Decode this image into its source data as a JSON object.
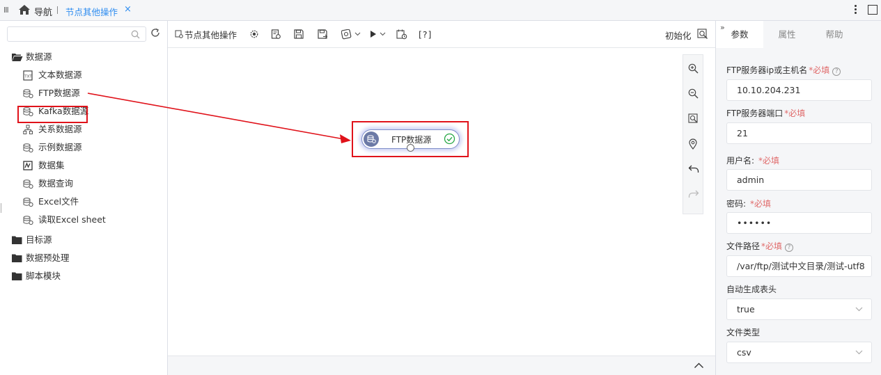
{
  "topbar": {
    "nav_label": "导航",
    "active_tab": "节点其他操作",
    "close_glyph": "×"
  },
  "tree": {
    "search_placeholder": "",
    "groups": [
      {
        "label": "数据源",
        "expanded": true,
        "items": [
          {
            "label": "文本数据源",
            "icon": "text-source-icon"
          },
          {
            "label": "FTP数据源",
            "icon": "database-source-icon",
            "highlighted": true
          },
          {
            "label": "Kafka数据源",
            "icon": "database-source-icon"
          },
          {
            "label": "关系数据源",
            "icon": "relation-source-icon"
          },
          {
            "label": "示例数据源",
            "icon": "database-source-icon"
          },
          {
            "label": "数据集",
            "icon": "dataset-icon"
          },
          {
            "label": "数据查询",
            "icon": "database-source-icon"
          },
          {
            "label": "Excel文件",
            "icon": "database-source-icon"
          },
          {
            "label": "读取Excel sheet",
            "icon": "database-source-icon"
          }
        ]
      },
      {
        "label": "目标源",
        "expanded": false
      },
      {
        "label": "数据预处理",
        "expanded": false
      },
      {
        "label": "脚本模块",
        "expanded": false
      }
    ]
  },
  "toolbar": {
    "node_ops_label": "节点其他操作",
    "help_label": "[?]",
    "init_label": "初始化"
  },
  "canvas": {
    "node": {
      "label": "FTP数据源",
      "status": "ok"
    }
  },
  "panel": {
    "tabs": [
      "参数",
      "属性",
      "帮助"
    ],
    "active_tab": "参数",
    "fields": [
      {
        "label": "FTP服务器ip或主机名",
        "required": "*必填",
        "help": "?",
        "value": "10.10.204.231"
      },
      {
        "label": "FTP服务器端口",
        "required": "*必填",
        "value": "21"
      },
      {
        "label": "用户名:",
        "required": "*必填",
        "value": "admin"
      },
      {
        "label": "密码:",
        "required": "*必填",
        "value": "••••••"
      },
      {
        "label": "文件路径",
        "required": "*必填",
        "help": "?",
        "value": "/var/ftp/测试中文目录/测试-utf8"
      },
      {
        "label": "自动生成表头",
        "value": "true",
        "dropdown": true
      },
      {
        "label": "文件类型",
        "value": "csv",
        "dropdown": true
      }
    ]
  },
  "colors": {
    "accent": "#2d8cf0",
    "highlight": "#e0121a",
    "required": "#e06a6a",
    "node_border": "#7f8ec8"
  }
}
